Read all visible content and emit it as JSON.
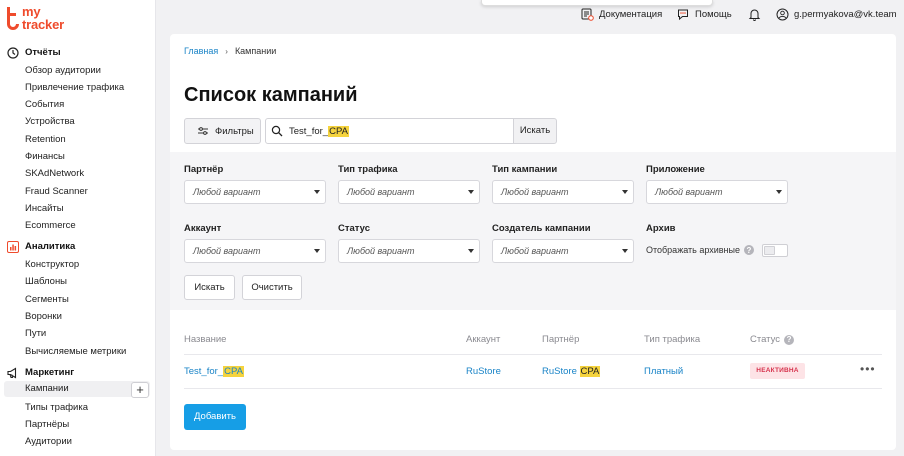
{
  "logo": {
    "line1": "my",
    "line2": "tracker"
  },
  "sidebar": {
    "sections": [
      {
        "label": "Отчёты",
        "icon": "clock-icon"
      },
      {
        "label": "Аналитика",
        "icon": "chart-icon"
      },
      {
        "label": "Маркетинг",
        "icon": "megaphone-icon"
      }
    ],
    "reports": [
      "Обзор аудитории",
      "Привлечение трафика",
      "События",
      "Устройства",
      "Retention",
      "Финансы",
      "SKAdNetwork",
      "Fraud Scanner",
      "Инсайты",
      "Ecommerce"
    ],
    "analytics": [
      "Конструктор",
      "Шаблоны",
      "Сегменты",
      "Воронки",
      "Пути",
      "Вычисляемые метрики"
    ],
    "marketing": [
      "Кампании",
      "Типы трафика",
      "Партнёры",
      "Аудитории"
    ],
    "active_item": "Кампании",
    "add_label": "+"
  },
  "topbar": {
    "docs": "Документация",
    "help": "Помощь",
    "user": "g.permyakova@vk.team"
  },
  "breadcrumb": {
    "home": "Главная",
    "separator": "›",
    "current": "Кампании"
  },
  "page_title": "Список кампаний",
  "toolbar": {
    "filters_label": "Фильтры",
    "search_value_prefix": "Test_for_",
    "search_value_highlight": "CPA",
    "search_button": "Искать"
  },
  "filters": {
    "partner": {
      "label": "Партнёр",
      "value": "Любой вариант"
    },
    "traffic_type": {
      "label": "Тип трафика",
      "value": "Любой вариант"
    },
    "campaign_type": {
      "label": "Тип кампании",
      "value": "Любой вариант"
    },
    "app": {
      "label": "Приложение",
      "value": "Любой вариант"
    },
    "account": {
      "label": "Аккаунт",
      "value": "Любой вариант"
    },
    "status": {
      "label": "Статус",
      "value": "Любой вариант"
    },
    "creator": {
      "label": "Создатель кампании",
      "value": "Любой вариант"
    },
    "archive": {
      "label": "Архив",
      "toggle_label": "Отображать архивные",
      "checked": false
    },
    "search_button": "Искать",
    "clear_button": "Очистить"
  },
  "table": {
    "headers": {
      "name": "Название",
      "account": "Аккаунт",
      "partner": "Партнёр",
      "traffic": "Тип трафика",
      "status": "Статус"
    },
    "rows": [
      {
        "name_prefix": "Test_for_",
        "name_highlight": "CPA",
        "account": "RuStore",
        "partner_prefix": "RuStore ",
        "partner_highlight": "CPA",
        "traffic": "Платный",
        "status": "НЕАКТИВНА",
        "menu": "•••"
      }
    ]
  },
  "add_button": "Добавить",
  "colors": {
    "accent": "#169ee6",
    "link": "#1a84c7",
    "brand": "#ef4b2c",
    "highlight": "#f5d33d",
    "inactive_badge_bg": "#fde3e6",
    "inactive_badge_text": "#d6334d"
  }
}
